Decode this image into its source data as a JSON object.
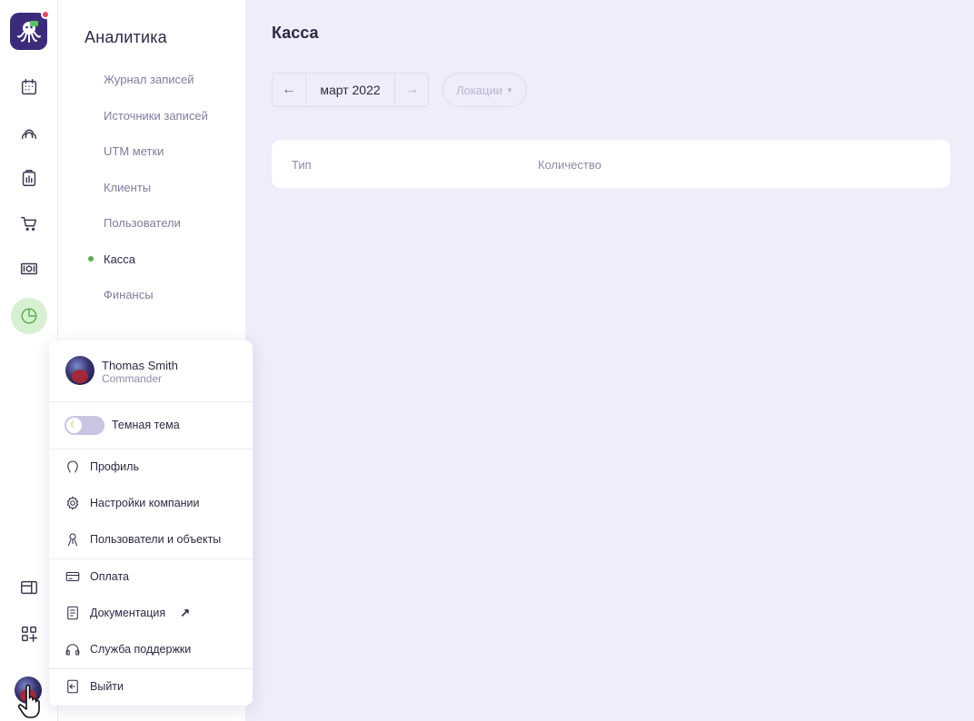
{
  "sidebar": {
    "title": "Аналитика",
    "items": [
      {
        "label": "Журнал записей",
        "active": false
      },
      {
        "label": "Источники записей",
        "active": false
      },
      {
        "label": "UTM метки",
        "active": false
      },
      {
        "label": "Клиенты",
        "active": false
      },
      {
        "label": "Пользователи",
        "active": false
      },
      {
        "label": "Касса",
        "active": true
      },
      {
        "label": "Финансы",
        "active": false
      }
    ]
  },
  "rail": {
    "icons": [
      "calendar-icon",
      "clients-icon",
      "clipboard-icon",
      "cart-icon",
      "cash-icon",
      "analytics-icon",
      "widget-icon",
      "apps-add-icon"
    ],
    "active": "analytics-icon",
    "accent": "#5cae52"
  },
  "main": {
    "title": "Касса",
    "month": "март 2022",
    "prev_arrow": "←",
    "next_arrow": "→",
    "locations_label": "Локации",
    "table": {
      "columns": [
        "Тип",
        "Количество"
      ]
    }
  },
  "user_menu": {
    "name": "Thomas Smith",
    "role": "Commander",
    "dark_theme_label": "Темная тема",
    "items": {
      "profile": "Профиль",
      "company_settings": "Настройки компании",
      "users_objects": "Пользователи и объекты",
      "payment": "Оплата",
      "docs": "Документация",
      "support": "Служба поддержки",
      "logout": "Выйти"
    }
  },
  "colors": {
    "background": "#efedf9",
    "brand": "#3b2b7a",
    "notification": "#e84a5f"
  }
}
